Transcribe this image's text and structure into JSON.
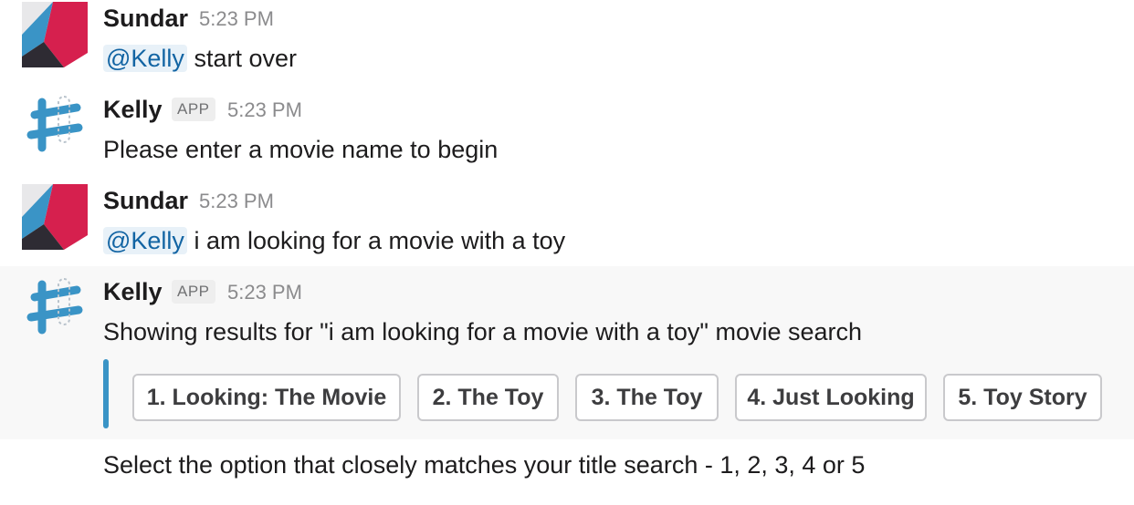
{
  "messages": [
    {
      "author": "Sundar",
      "time": "5:23 PM",
      "mention": "@Kelly",
      "text": "start over"
    },
    {
      "author": "Kelly",
      "badge": "APP",
      "time": "5:23 PM",
      "text": "Please enter a movie name to begin"
    },
    {
      "author": "Sundar",
      "time": "5:23 PM",
      "mention": "@Kelly",
      "text": "i am looking for a movie with a toy"
    },
    {
      "author": "Kelly",
      "badge": "APP",
      "time": "5:23 PM",
      "text": "Showing results for \"i am looking for a movie with a toy\" movie search"
    }
  ],
  "options": [
    {
      "label": "1. Looking: The Movie"
    },
    {
      "label": "2. The Toy"
    },
    {
      "label": "3. The Toy"
    },
    {
      "label": "4. Just Looking"
    },
    {
      "label": "5. Toy Story"
    }
  ],
  "footer_text": "Select the option that closely matches your title search - 1, 2, 3, 4 or 5",
  "colors": {
    "mention": "#1264a3",
    "attachment_bar": "#3a94c6",
    "sundar_avatar_red": "#d6204e",
    "sundar_avatar_blue": "#3a94c6",
    "sundar_avatar_dark": "#2e2b33",
    "kelly_avatar_blue": "#3a94c6"
  },
  "icons": {
    "sundar_avatar": "sundar-avatar-icon",
    "kelly_avatar": "kelly-bot-avatar-icon"
  }
}
